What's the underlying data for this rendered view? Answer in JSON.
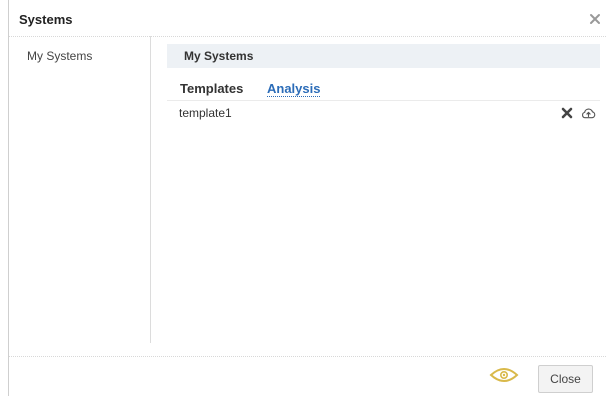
{
  "dialog": {
    "title": "Systems",
    "close_icon": "close-icon"
  },
  "sidebar": {
    "items": [
      {
        "label": "My Systems"
      }
    ]
  },
  "main": {
    "section_title": "My Systems",
    "tabs": [
      {
        "label": "Templates",
        "active": false
      },
      {
        "label": "Analysis",
        "active": true
      }
    ],
    "rows": [
      {
        "label": "template1",
        "actions": [
          "delete-icon",
          "upload-icon"
        ]
      }
    ]
  },
  "footer": {
    "preview_icon": "eye-icon",
    "close_label": "Close"
  },
  "colors": {
    "link": "#2b6cb8",
    "header_bg": "#edf1f5",
    "eye": "#d9b94a"
  }
}
